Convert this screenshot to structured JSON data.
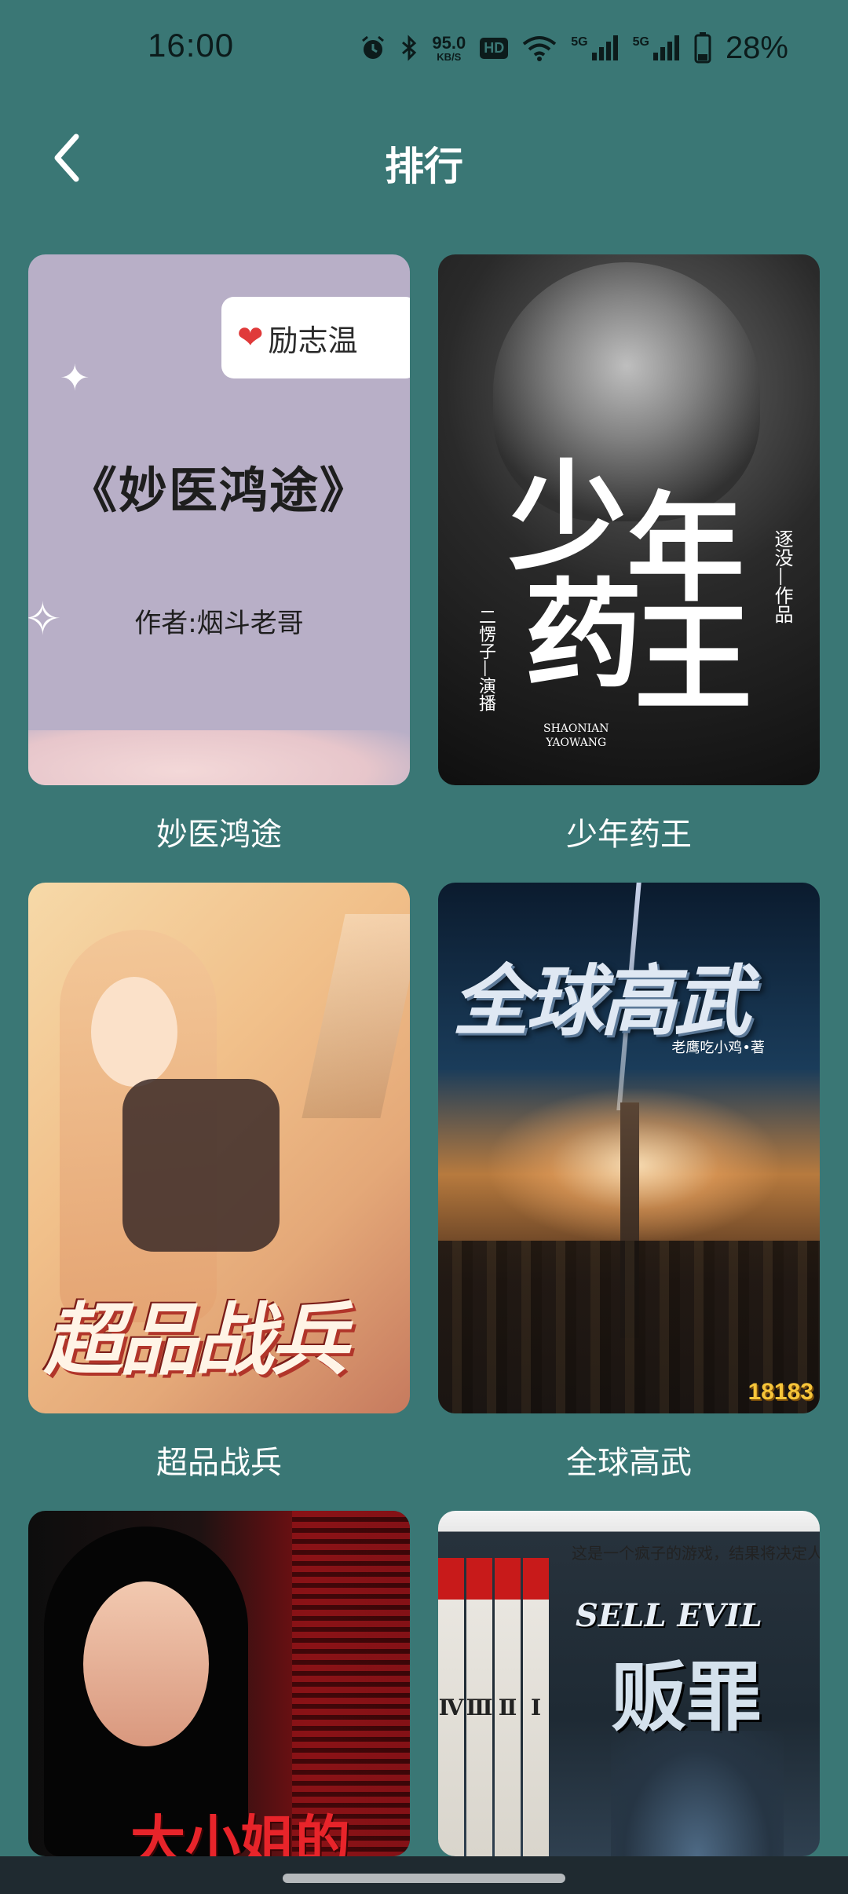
{
  "status_bar": {
    "time": "16:00",
    "net_speed_value": "95.0",
    "net_speed_unit": "KB/S",
    "hd_label": "HD",
    "sim1_label": "5G",
    "sim2_label": "5G",
    "battery": "28%"
  },
  "header": {
    "title": "排行",
    "back_icon": "back-arrow-icon"
  },
  "books": [
    {
      "title": "妙医鸿途",
      "cover": {
        "tag": "励志温",
        "big_title": "《妙医鸿途》",
        "author": "作者:烟斗老哥"
      }
    },
    {
      "title": "少年药王",
      "cover": {
        "chars": [
          "少",
          "年",
          "药",
          "王"
        ],
        "side_right": "逐没—作品",
        "side_left": "二愣子—演播",
        "pinyin_1": "SHAONIAN",
        "pinyin_2": "YAOWANG"
      }
    },
    {
      "title": "超品战兵",
      "cover": {
        "logo": "超品战兵"
      }
    },
    {
      "title": "全球高武",
      "cover": {
        "logo": "全球高武",
        "author_line": "老鹰吃小鸡•著",
        "badge": "18183"
      }
    },
    {
      "title": "",
      "cover": {
        "logo": "大小姐的"
      }
    },
    {
      "title": "",
      "cover": {
        "topline": "这是一个疯子的游戏，结果将决定人类的未",
        "sell_evil": "SELL  EVIL",
        "big": "贩罪",
        "volumes": [
          "Ⅳ",
          "Ⅲ",
          "Ⅱ",
          "Ⅰ"
        ]
      }
    }
  ]
}
